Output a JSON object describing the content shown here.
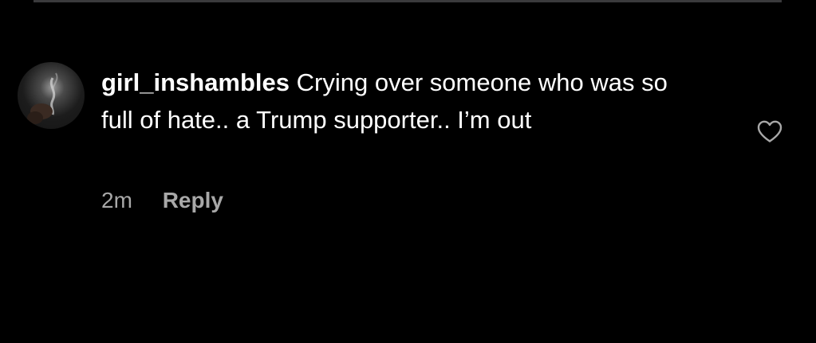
{
  "comment": {
    "username": "girl_inshambles",
    "text": "Crying over someone who was so full of hate.. a Trump supporter.. I’m out",
    "timestamp": "2m",
    "reply_label": "Reply",
    "avatar_icon": "profile-avatar",
    "like_icon": "heart-outline-icon"
  },
  "colors": {
    "background": "#000000",
    "text_primary": "#ffffff",
    "text_secondary": "#a8a8a8",
    "divider": "#3a3a3c"
  }
}
